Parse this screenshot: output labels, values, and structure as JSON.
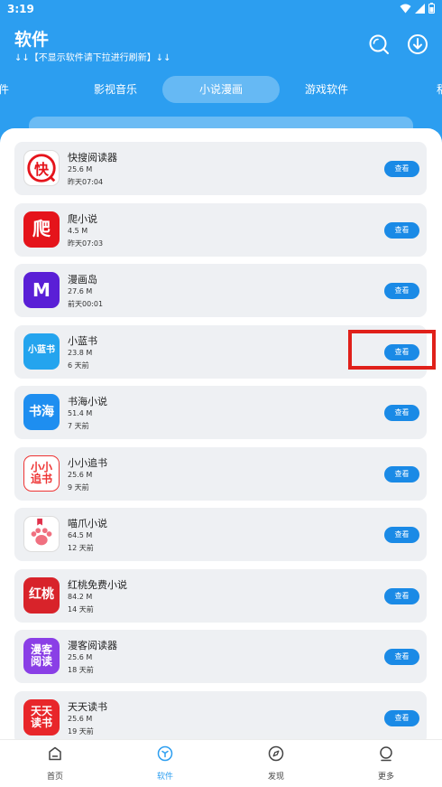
{
  "status": {
    "time": "3:19"
  },
  "header": {
    "title": "软件",
    "subtitle": "↓↓【不显示软件请下拉进行刷新】↓↓"
  },
  "tabs": [
    {
      "label": "件"
    },
    {
      "label": "影视音乐"
    },
    {
      "label": "小说漫画",
      "active": true
    },
    {
      "label": "游戏软件"
    },
    {
      "label": "稆"
    }
  ],
  "apps": [
    {
      "name": "快搜阅读器",
      "size": "25.6 M",
      "time": "昨天07:04",
      "button": "查看",
      "icon": "kuaisou-icon",
      "icon_text": "快"
    },
    {
      "name": "爬小说",
      "size": "4.5 M",
      "time": "昨天07:03",
      "button": "查看",
      "icon": "paxiaoshuo-icon",
      "icon_text": "爬"
    },
    {
      "name": "漫画岛",
      "size": "27.6 M",
      "time": "前天00:01",
      "button": "查看",
      "icon": "manhuadao-icon",
      "icon_text": "M"
    },
    {
      "name": "小蓝书",
      "size": "23.8 M",
      "time": "6 天前",
      "button": "查看",
      "icon": "xiaolanshu-icon",
      "icon_text": "小蓝书"
    },
    {
      "name": "书海小说",
      "size": "51.4 M",
      "time": "7 天前",
      "button": "查看",
      "icon": "shuhai-icon",
      "icon_text": "书海"
    },
    {
      "name": "小小追书",
      "size": "25.6 M",
      "time": "9 天前",
      "button": "查看",
      "icon": "xiaoxiaozhuishu-icon",
      "icon_text": "小小追书"
    },
    {
      "name": "喵爪小说",
      "size": "64.5 M",
      "time": "12 天前",
      "button": "查看",
      "icon": "cat-paw-icon",
      "icon_text": ""
    },
    {
      "name": "红桃免费小说",
      "size": "84.2 M",
      "time": "14 天前",
      "button": "查看",
      "icon": "hongtao-icon",
      "icon_text": "红桃"
    },
    {
      "name": "漫客阅读器",
      "size": "25.6 M",
      "time": "18 天前",
      "button": "查看",
      "icon": "manke-icon",
      "icon_text": "漫客阅读"
    },
    {
      "name": "天天读书",
      "size": "25.6 M",
      "time": "19 天前",
      "button": "查看",
      "icon": "tiantiandushu-icon",
      "icon_text": "天天读书"
    }
  ],
  "bottom_nav": [
    {
      "label": "首页",
      "icon": "home-icon"
    },
    {
      "label": "软件",
      "icon": "software-icon",
      "active": true
    },
    {
      "label": "发现",
      "icon": "compass-icon"
    },
    {
      "label": "更多",
      "icon": "more-icon"
    }
  ],
  "colors": {
    "header": "#2c9ef0",
    "button": "#1a8ae6",
    "highlight": "#e0201a"
  }
}
